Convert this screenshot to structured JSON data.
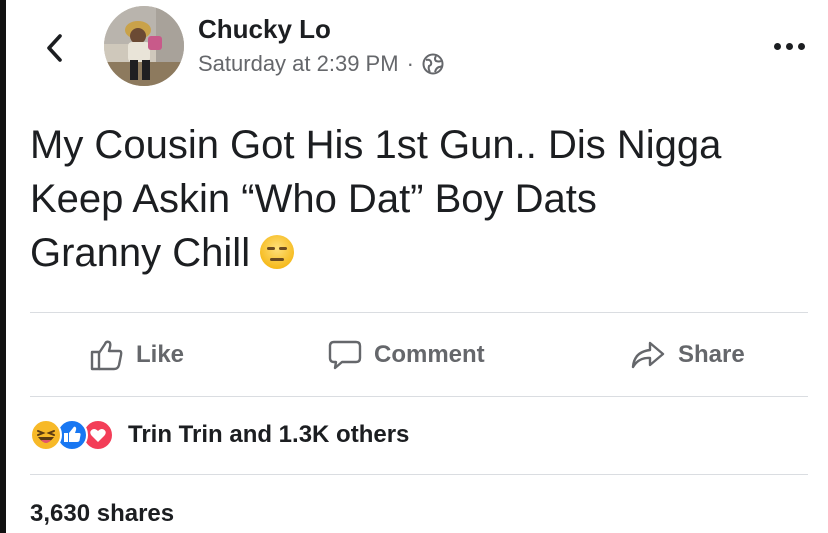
{
  "header": {
    "back_icon": "chevron-left-icon",
    "author_name": "Chucky Lo",
    "timestamp": "Saturday at 2:39 PM",
    "separator": "·",
    "privacy_icon": "globe-icon",
    "more_icon": "more-options-icon"
  },
  "post": {
    "text_lines": [
      "My Cousin Got His 1st Gun.. Dis Nigga",
      "Keep Askin “Who Dat” Boy Dats",
      "Granny Chill"
    ],
    "emoji": "expressionless-face-emoji"
  },
  "actions": {
    "like_label": "Like",
    "comment_label": "Comment",
    "share_label": "Share"
  },
  "reactions": {
    "icons": [
      "haha-reaction-icon",
      "like-reaction-icon",
      "love-reaction-icon"
    ],
    "summary": "Trin Trin and 1.3K others"
  },
  "stats": {
    "shares": "3,630 shares"
  },
  "colors": {
    "text_primary": "#1c1e21",
    "text_secondary": "#65676b",
    "like_blue": "#1877f2",
    "love_red": "#f33e58",
    "haha_yellow": "#f7b928",
    "divider": "#dadde1"
  }
}
